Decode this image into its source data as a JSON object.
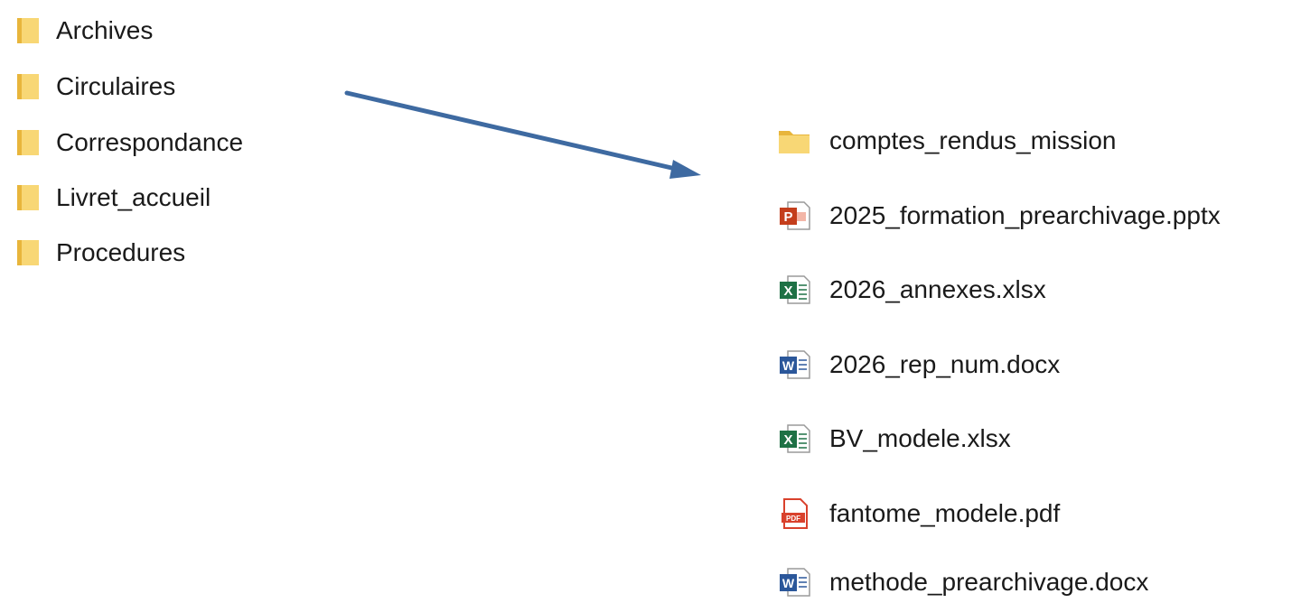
{
  "left_folders": [
    {
      "label": "Archives",
      "icon": "folder-icon"
    },
    {
      "label": "Circulaires",
      "icon": "folder-icon"
    },
    {
      "label": "Correspondance",
      "icon": "folder-icon"
    },
    {
      "label": "Livret_accueil",
      "icon": "folder-icon"
    },
    {
      "label": "Procedures",
      "icon": "folder-icon"
    }
  ],
  "right_items": [
    {
      "label": "comptes_rendus_mission",
      "icon": "folder-icon"
    },
    {
      "label": "2025_formation_prearchivage.pptx",
      "icon": "powerpoint-icon"
    },
    {
      "label": "2026_annexes.xlsx",
      "icon": "excel-icon"
    },
    {
      "label": "2026_rep_num.docx",
      "icon": "word-icon"
    },
    {
      "label": "BV_modele.xlsx",
      "icon": "excel-icon"
    },
    {
      "label": "fantome_modele.pdf",
      "icon": "pdf-icon"
    },
    {
      "label": "methode_prearchivage.docx",
      "icon": "word-icon"
    }
  ],
  "colors": {
    "folder": "#f8d775",
    "folder_dark": "#e8b53b",
    "arrow": "#3e6aa1",
    "powerpoint": "#c43e1c",
    "excel": "#1e7145",
    "word": "#2b579a",
    "pdf": "#d9412c"
  }
}
